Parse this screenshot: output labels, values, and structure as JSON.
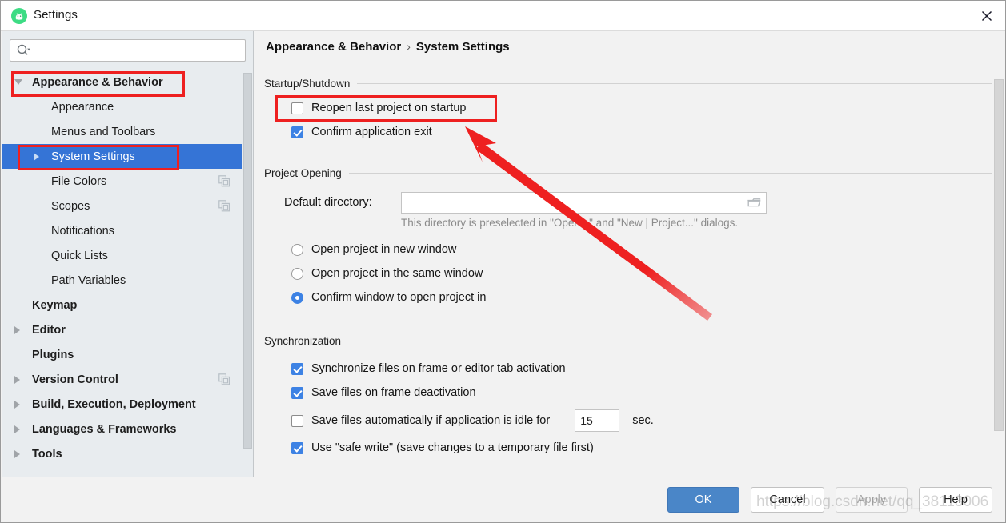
{
  "window": {
    "title": "Settings",
    "app_icon": "android-studio-icon",
    "close_icon": "close-icon"
  },
  "sidebar": {
    "search": {
      "value": "",
      "placeholder": "",
      "icon": "search-icon"
    },
    "items": [
      {
        "label": "Appearance & Behavior",
        "level": 1,
        "twisty": "open",
        "bold": true,
        "selected": false,
        "copy": false
      },
      {
        "label": "Appearance",
        "level": 2,
        "twisty": "none",
        "bold": false,
        "selected": false,
        "copy": false
      },
      {
        "label": "Menus and Toolbars",
        "level": 2,
        "twisty": "none",
        "bold": false,
        "selected": false,
        "copy": false
      },
      {
        "label": "System Settings",
        "level": 2,
        "twisty": "closed",
        "bold": false,
        "selected": true,
        "copy": false
      },
      {
        "label": "File Colors",
        "level": 2,
        "twisty": "none",
        "bold": false,
        "selected": false,
        "copy": true
      },
      {
        "label": "Scopes",
        "level": 2,
        "twisty": "none",
        "bold": false,
        "selected": false,
        "copy": true
      },
      {
        "label": "Notifications",
        "level": 2,
        "twisty": "none",
        "bold": false,
        "selected": false,
        "copy": false
      },
      {
        "label": "Quick Lists",
        "level": 2,
        "twisty": "none",
        "bold": false,
        "selected": false,
        "copy": false
      },
      {
        "label": "Path Variables",
        "level": 2,
        "twisty": "none",
        "bold": false,
        "selected": false,
        "copy": false
      },
      {
        "label": "Keymap",
        "level": 1,
        "twisty": "none",
        "bold": true,
        "selected": false,
        "copy": false
      },
      {
        "label": "Editor",
        "level": 1,
        "twisty": "closed",
        "bold": true,
        "selected": false,
        "copy": false
      },
      {
        "label": "Plugins",
        "level": 1,
        "twisty": "none",
        "bold": true,
        "selected": false,
        "copy": false
      },
      {
        "label": "Version Control",
        "level": 1,
        "twisty": "closed",
        "bold": true,
        "selected": false,
        "copy": true
      },
      {
        "label": "Build, Execution, Deployment",
        "level": 1,
        "twisty": "closed",
        "bold": true,
        "selected": false,
        "copy": false
      },
      {
        "label": "Languages & Frameworks",
        "level": 1,
        "twisty": "closed",
        "bold": true,
        "selected": false,
        "copy": false
      },
      {
        "label": "Tools",
        "level": 1,
        "twisty": "closed",
        "bold": true,
        "selected": false,
        "copy": false
      }
    ]
  },
  "breadcrumb": {
    "parent": "Appearance & Behavior",
    "separator": "›",
    "current": "System Settings"
  },
  "sections": {
    "startup": {
      "title": "Startup/Shutdown",
      "reopen_last_project": {
        "label": "Reopen last project on startup",
        "checked": false
      },
      "confirm_exit": {
        "label": "Confirm application exit",
        "checked": true
      }
    },
    "project_opening": {
      "title": "Project Opening",
      "default_directory_label": "Default directory:",
      "default_directory_value": "",
      "browse_icon": "folder-icon",
      "hint": "This directory is preselected in \"Open...\" and \"New | Project...\" dialogs.",
      "radios": [
        {
          "label": "Open project in new window",
          "checked": false
        },
        {
          "label": "Open project in the same window",
          "checked": false
        },
        {
          "label": "Confirm window to open project in",
          "checked": true
        }
      ]
    },
    "synchronization": {
      "title": "Synchronization",
      "items": [
        {
          "label": "Synchronize files on frame or editor tab activation",
          "checked": true
        },
        {
          "label": "Save files on frame deactivation",
          "checked": true
        },
        {
          "label": "Save files automatically if application is idle for",
          "checked": false
        },
        {
          "label": "Use \"safe write\" (save changes to a temporary file first)",
          "checked": true
        }
      ],
      "idle_seconds": "15",
      "idle_unit": "sec."
    }
  },
  "buttons": {
    "ok": "OK",
    "cancel": "Cancel",
    "apply": "Apply",
    "help": "Help"
  },
  "annotations": {
    "watermark": "https://blog.csdn.net/qq_38113006",
    "highlight_color": "#ee2020",
    "arrow_color": "#ee2020"
  },
  "colors": {
    "accent": "#3574d6",
    "checkbox_checked": "#3d82e4",
    "ok_button": "#4a86c8",
    "sidebar_bg": "#e8ecef",
    "panel_bg": "#f2f2f2"
  }
}
